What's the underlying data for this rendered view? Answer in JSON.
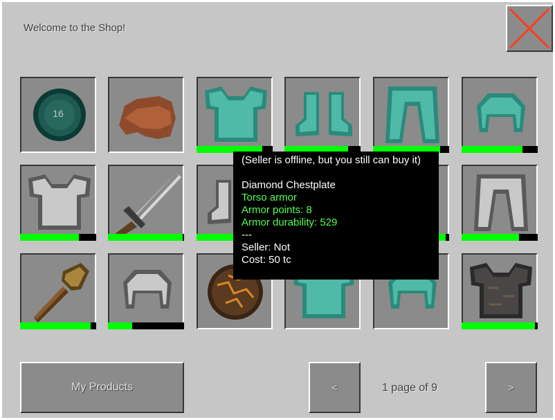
{
  "title": "Welcome to the Shop!",
  "close_button": {
    "icon": "close-icon",
    "color": "#ff3b1e"
  },
  "slots": [
    {
      "row": 0,
      "col": 0,
      "item": "ender-pearl-icon",
      "badge": "16",
      "durability": null
    },
    {
      "row": 0,
      "col": 1,
      "item": "leather-cap-icon",
      "durability": null
    },
    {
      "row": 0,
      "col": 2,
      "item": "diamond-chestplate-icon",
      "durability": 0.86
    },
    {
      "row": 0,
      "col": 3,
      "item": "diamond-boots-icon",
      "durability": 0.84
    },
    {
      "row": 0,
      "col": 4,
      "item": "diamond-leggings-icon",
      "durability": 0.88
    },
    {
      "row": 0,
      "col": 5,
      "item": "diamond-helmet-icon",
      "durability": 0.8
    },
    {
      "row": 1,
      "col": 0,
      "item": "iron-chestplate-icon",
      "durability": 0.77
    },
    {
      "row": 1,
      "col": 1,
      "item": "iron-sword-icon",
      "durability": 0.98
    },
    {
      "row": 1,
      "col": 2,
      "item": "iron-boots-icon",
      "durability": 0.5
    },
    {
      "row": 1,
      "col": 3,
      "item": "hidden-slot-icon",
      "durability": null
    },
    {
      "row": 1,
      "col": 4,
      "item": "hidden-slot-icon",
      "durability": 0.95
    },
    {
      "row": 1,
      "col": 5,
      "item": "iron-leggings-icon",
      "durability": 0.75
    },
    {
      "row": 2,
      "col": 0,
      "item": "wooden-shovel-icon",
      "durability": 0.93
    },
    {
      "row": 2,
      "col": 1,
      "item": "iron-helmet-icon",
      "durability": 0.32
    },
    {
      "row": 2,
      "col": 2,
      "item": "magma-block-icon",
      "durability": null
    },
    {
      "row": 2,
      "col": 3,
      "item": "diamond-chestplate-icon",
      "durability": null
    },
    {
      "row": 2,
      "col": 4,
      "item": "diamond-helmet-icon",
      "durability": null
    },
    {
      "row": 2,
      "col": 5,
      "item": "netherite-chestplate-icon",
      "durability": 0.96
    }
  ],
  "tooltip": {
    "lines": [
      {
        "text": "(Seller is offline, but you still can buy it)",
        "color": "white"
      },
      {
        "text": "",
        "color": "white"
      },
      {
        "text": "Diamond Chestplate",
        "color": "white"
      },
      {
        "text": "Torso armor",
        "color": "green"
      },
      {
        "text": "Armor points: 8",
        "color": "green"
      },
      {
        "text": "Armor durability: 529",
        "color": "green"
      },
      {
        "text": "---",
        "color": "white"
      },
      {
        "text": "Seller: Not",
        "color": "white"
      },
      {
        "text": "Cost: 50 tc",
        "color": "white"
      }
    ]
  },
  "footer": {
    "my_products": "My Products",
    "prev": "<",
    "next": ">",
    "page_label": "1 page of 9"
  }
}
